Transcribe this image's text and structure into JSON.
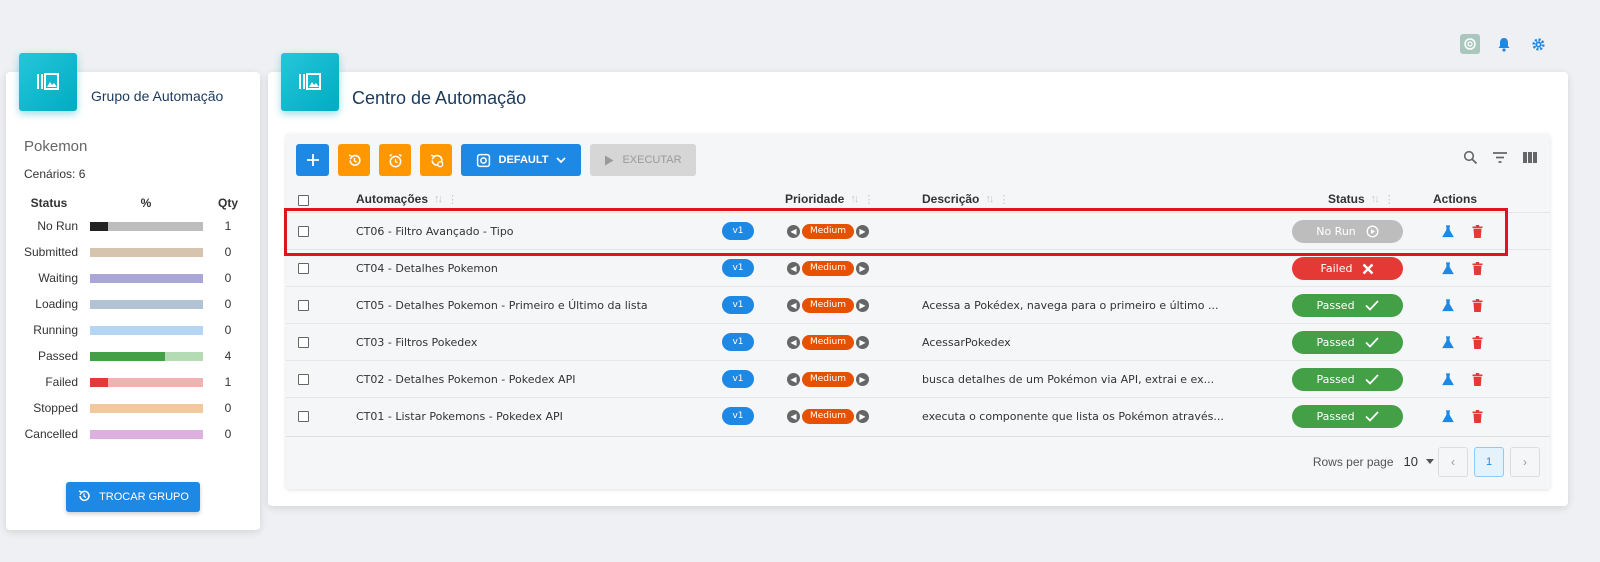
{
  "top_icons": [
    "chatgpt-icon",
    "bell-icon",
    "gear-icon"
  ],
  "side": {
    "title": "Grupo de Automação",
    "group_name": "Pokemon",
    "scenarios": "Cenários: 6",
    "head": {
      "status": "Status",
      "percent": "%",
      "qty": "Qty"
    },
    "stats": [
      {
        "label": "No Run",
        "qty": "1",
        "fill": 0.167,
        "color": "#222222",
        "track": "#bdbdbd"
      },
      {
        "label": "Submitted",
        "qty": "0",
        "fill": 0,
        "color": "#8d6e63",
        "track": "#d7c4ae"
      },
      {
        "label": "Waiting",
        "qty": "0",
        "fill": 0,
        "color": "#5c6bc0",
        "track": "#aaa7d8"
      },
      {
        "label": "Loading",
        "qty": "0",
        "fill": 0,
        "color": "#607d8b",
        "track": "#b2c4d4"
      },
      {
        "label": "Running",
        "qty": "0",
        "fill": 0,
        "color": "#42a5f5",
        "track": "#b4d6f4"
      },
      {
        "label": "Passed",
        "qty": "4",
        "fill": 0.667,
        "color": "#43a047",
        "track": "#b4dcb4"
      },
      {
        "label": "Failed",
        "qty": "1",
        "fill": 0.167,
        "color": "#e53935",
        "track": "#f3b2b2"
      },
      {
        "label": "Stopped",
        "qty": "0",
        "fill": 0,
        "color": "#ff9800",
        "track": "#f2c99e"
      },
      {
        "label": "Cancelled",
        "qty": "0",
        "fill": 0,
        "color": "#ab47bc",
        "track": "#ddb0e0"
      }
    ],
    "change_button": "TROCAR GRUPO"
  },
  "main": {
    "title": "Centro de Automação",
    "toolbar": {
      "default_label": "DEFAULT",
      "execute_label": "EXECUTAR"
    },
    "columns": {
      "automations": "Automações",
      "priority": "Prioridade",
      "description": "Descrição",
      "status": "Status",
      "actions": "Actions"
    },
    "rows": [
      {
        "name": "CT06 - Filtro Avançado - Tipo",
        "version": "v1",
        "priority": "Medium",
        "description": "",
        "status": "No Run",
        "status_kind": "norun"
      },
      {
        "name": "CT04 - Detalhes Pokemon",
        "version": "v1",
        "priority": "Medium",
        "description": "",
        "status": "Failed",
        "status_kind": "failed"
      },
      {
        "name": "CT05 - Detalhes Pokemon - Primeiro e Último da lista",
        "version": "v1",
        "priority": "Medium",
        "description": "Acessa a Pokédex, navega para o primeiro e último ...",
        "status": "Passed",
        "status_kind": "passed"
      },
      {
        "name": "CT03 - Filtros Pokedex",
        "version": "v1",
        "priority": "Medium",
        "description": "AcessarPokedex",
        "status": "Passed",
        "status_kind": "passed"
      },
      {
        "name": "CT02 - Detalhes Pokemon - Pokedex API",
        "version": "v1",
        "priority": "Medium",
        "description": "busca detalhes de um Pokémon via API, extrai e ex...",
        "status": "Passed",
        "status_kind": "passed"
      },
      {
        "name": "CT01 - Listar Pokemons - Pokedex API",
        "version": "v1",
        "priority": "Medium",
        "description": "executa o componente que lista os Pokémon através...",
        "status": "Passed",
        "status_kind": "passed"
      }
    ],
    "footer": {
      "rows_per_page_label": "Rows per page",
      "rows_per_page": "10",
      "current_page": "1"
    }
  }
}
